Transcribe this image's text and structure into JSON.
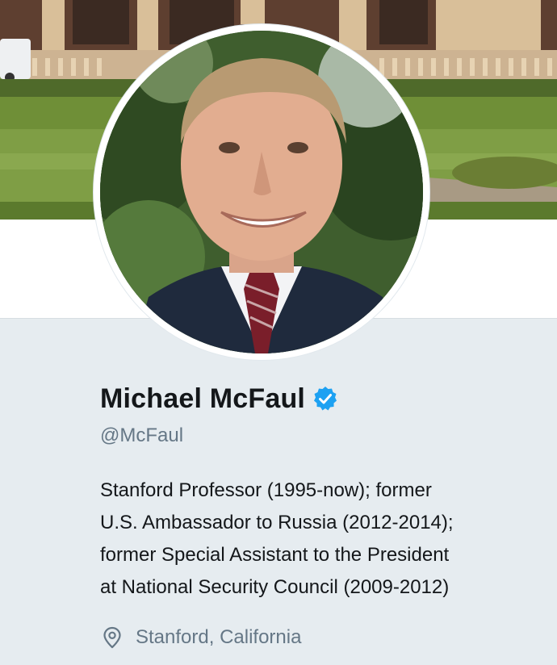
{
  "profile": {
    "name": "Michael McFaul",
    "verified": true,
    "handle": "@McFaul",
    "bio_lines": [
      "Stanford Professor (1995-now); former",
      "U.S. Ambassador to Russia (2012-2014);",
      "former Special Assistant to the President",
      "at National Security Council (2009-2012)"
    ],
    "location": "Stanford, California"
  },
  "icons": {
    "verified": "verified-badge-icon",
    "location": "location-pin-icon"
  },
  "colors": {
    "verified_badge": "#1da1f2",
    "name_text": "#14171a",
    "muted_text": "#657786",
    "card_background": "#e6ecf0"
  }
}
